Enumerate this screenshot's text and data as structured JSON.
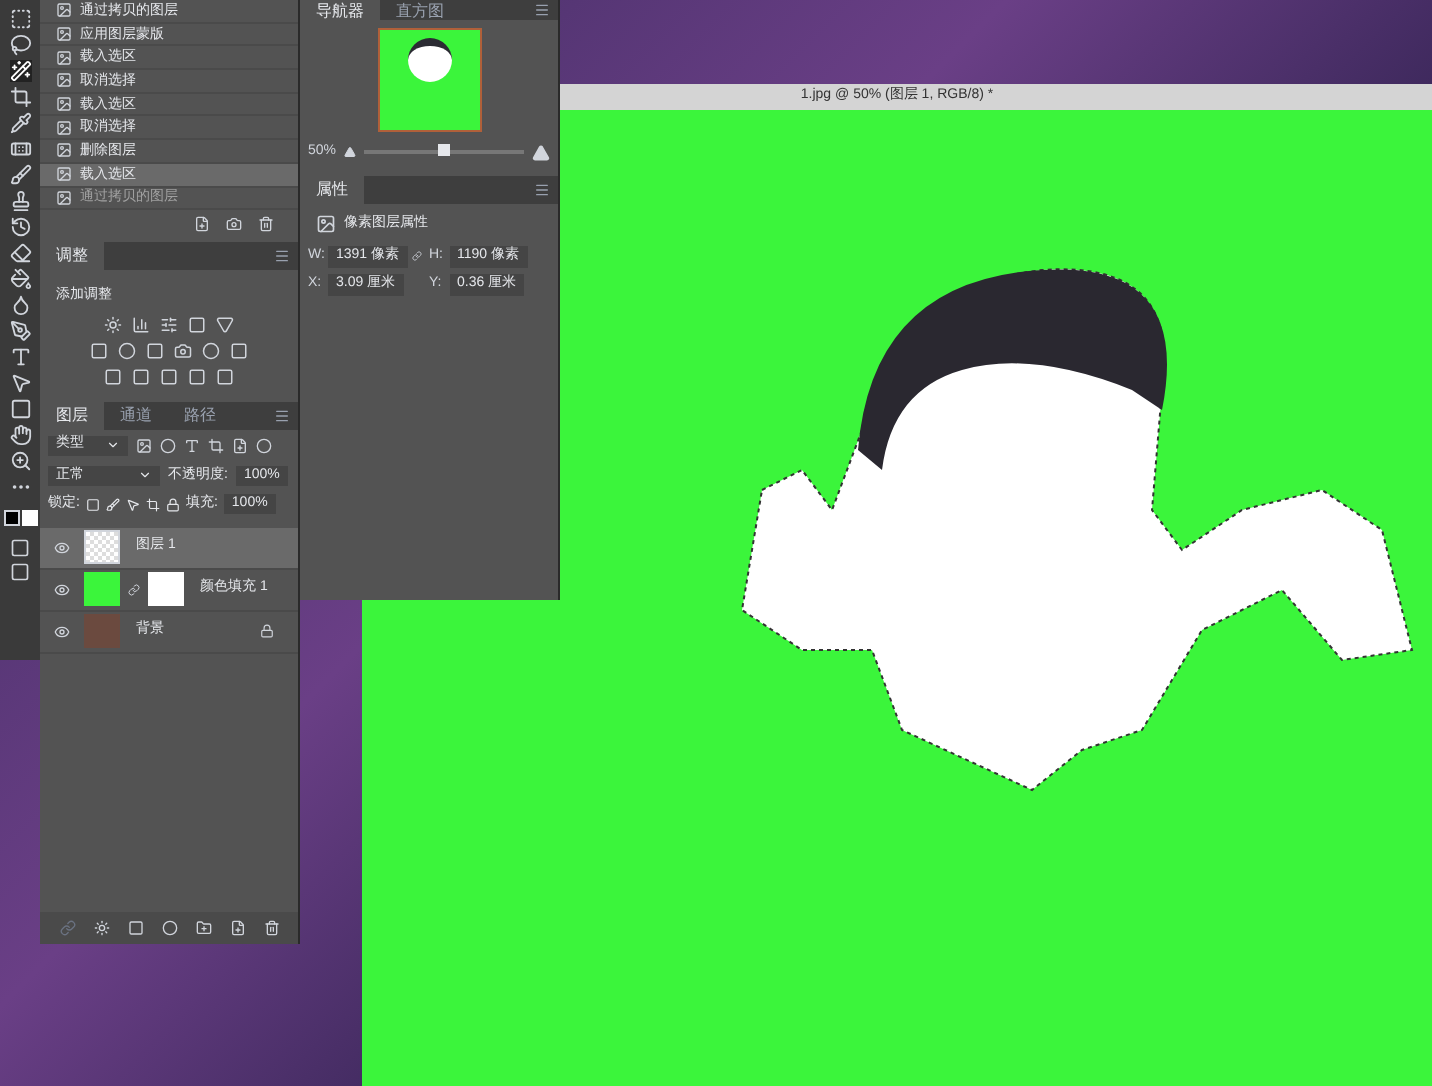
{
  "history": {
    "items": [
      {
        "label": "通过拷贝的图层",
        "selected": false,
        "disabled": false
      },
      {
        "label": "应用图层蒙版",
        "selected": false,
        "disabled": false
      },
      {
        "label": "载入选区",
        "selected": false,
        "disabled": false
      },
      {
        "label": "取消选择",
        "selected": false,
        "disabled": false
      },
      {
        "label": "载入选区",
        "selected": false,
        "disabled": false
      },
      {
        "label": "取消选择",
        "selected": false,
        "disabled": false
      },
      {
        "label": "删除图层",
        "selected": false,
        "disabled": false
      },
      {
        "label": "载入选区",
        "selected": true,
        "disabled": false
      },
      {
        "label": "通过拷贝的图层",
        "selected": false,
        "disabled": true
      }
    ]
  },
  "navigator": {
    "tabs": [
      {
        "label": "导航器",
        "selected": true
      },
      {
        "label": "直方图",
        "selected": false
      }
    ],
    "zoom": "50%",
    "level": 0.5
  },
  "properties": {
    "title": "属性",
    "subtitle": "像素图层属性",
    "fields": [
      {
        "label": "W:",
        "value": "1391 像素"
      },
      {
        "label": "H:",
        "value": "1190 像素"
      },
      {
        "label": "X:",
        "value": "3.09 厘米"
      },
      {
        "label": "Y:",
        "value": "0.36 厘米"
      }
    ]
  },
  "adjustments": {
    "title": "调整",
    "heading": "添加调整"
  },
  "layers_panel": {
    "tabs": [
      {
        "label": "图层",
        "selected": true
      },
      {
        "label": "通道",
        "selected": false
      },
      {
        "label": "路径",
        "selected": false
      }
    ],
    "filter": "类型",
    "blend_mode": "正常",
    "opacity_label": "不透明度:",
    "opacity": "100%",
    "lock_label": "锁定:",
    "fill_label": "填充:",
    "fill": "100%",
    "layers": [
      {
        "name": "图层 1",
        "kind": "transparent",
        "selected": true,
        "locked": false
      },
      {
        "name": "颜色填充 1",
        "kind": "fill",
        "selected": false,
        "locked": false
      },
      {
        "name": "背景",
        "kind": "photo",
        "selected": false,
        "locked": true
      }
    ]
  },
  "document": {
    "title": "1.jpg @ 50% (图层 1, RGB/8) *"
  }
}
